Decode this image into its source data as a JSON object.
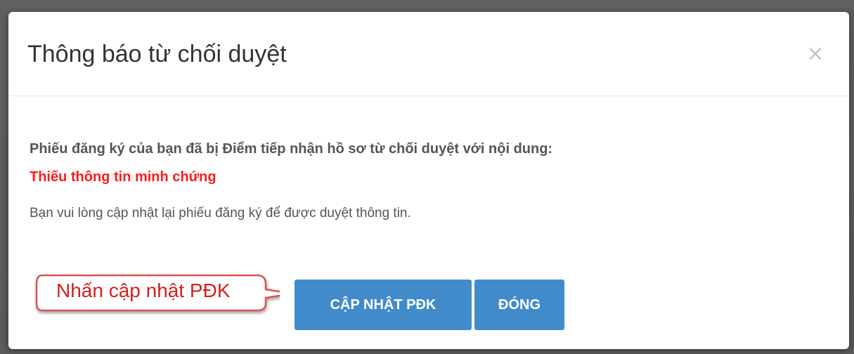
{
  "dialog": {
    "title": "Thông báo từ chối duyệt",
    "close_symbol": "×",
    "close_icon": "close-icon"
  },
  "body": {
    "message": "Phiếu đăng ký của bạn đã bị Điểm tiếp nhận hồ sơ từ chối duyệt với nội dung:",
    "reason": "Thiếu thông tin minh chứng",
    "instruction": "Bạn vui lòng cập nhật lại phiếu đăng ký để được duyệt thông tin."
  },
  "annotation": {
    "callout_text": "Nhấn cập nhật PĐK"
  },
  "actions": {
    "update_label": "CẬP NHẬT PĐK",
    "close_label": "ĐÓNG"
  },
  "colors": {
    "primary_button": "#428bca",
    "reason_text": "#ff1a1a",
    "callout_border": "#d9534f",
    "overlay": "#5e5e5e"
  }
}
